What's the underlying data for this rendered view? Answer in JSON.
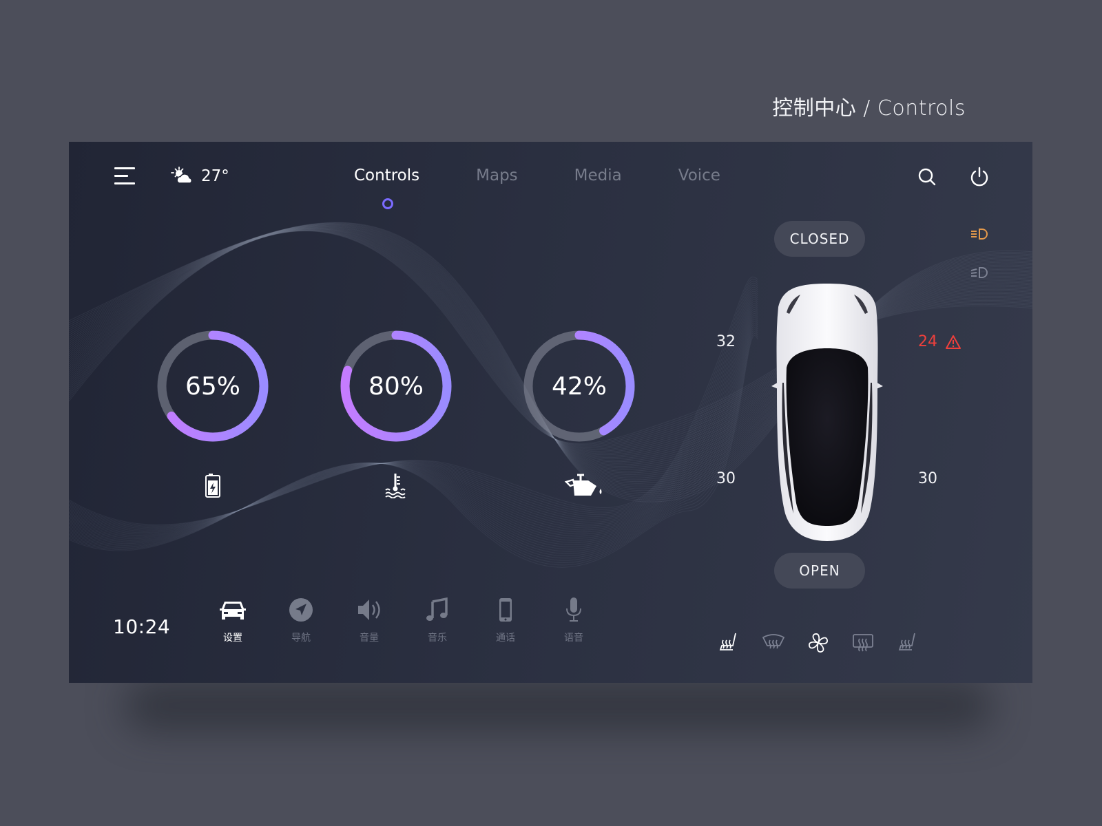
{
  "page_title": "控制中心 / Controls",
  "header": {
    "weather_icon": "partly-sunny-icon",
    "temperature": "27°",
    "tabs": [
      {
        "label": "Controls",
        "active": true
      },
      {
        "label": "Maps",
        "active": false
      },
      {
        "label": "Media",
        "active": false
      },
      {
        "label": "Voice",
        "active": false
      }
    ],
    "actions": [
      "search-icon",
      "power-icon"
    ]
  },
  "gauges": [
    {
      "name": "battery",
      "value": 65,
      "label": "65%",
      "icon": "battery-charging-icon"
    },
    {
      "name": "coolant-temperature",
      "value": 80,
      "label": "80%",
      "icon": "coolant-temperature-icon"
    },
    {
      "name": "oil",
      "value": 42,
      "label": "42%",
      "icon": "oil-can-icon"
    }
  ],
  "car": {
    "trunk_top_status": "CLOSED",
    "trunk_bottom_status": "OPEN",
    "tire_pressure": {
      "front_left": "32",
      "front_right": "24",
      "rear_left": "30",
      "rear_right": "30"
    },
    "front_right_warning": true,
    "lights": [
      {
        "name": "low-beam",
        "active": true
      },
      {
        "name": "high-beam",
        "active": false
      }
    ]
  },
  "clock": "10:24",
  "dock": [
    {
      "label": "设置",
      "icon": "car-icon",
      "active": true
    },
    {
      "label": "导航",
      "icon": "navigation-icon",
      "active": false
    },
    {
      "label": "音量",
      "icon": "volume-icon",
      "active": false
    },
    {
      "label": "音乐",
      "icon": "music-icon",
      "active": false
    },
    {
      "label": "通话",
      "icon": "phone-icon",
      "active": false
    },
    {
      "label": "语音",
      "icon": "microphone-icon",
      "active": false
    }
  ],
  "climate": [
    {
      "name": "seat-heat-left",
      "active": true
    },
    {
      "name": "front-defrost",
      "active": false
    },
    {
      "name": "fan",
      "active": true
    },
    {
      "name": "rear-defrost",
      "active": false
    },
    {
      "name": "seat-heat-right",
      "active": false
    }
  ],
  "colors": {
    "accent_start": "#c57cff",
    "accent_end": "#9a8cff",
    "warning": "#f0403c",
    "light_active": "#e59a4b",
    "indicator": "#7b6bff"
  }
}
